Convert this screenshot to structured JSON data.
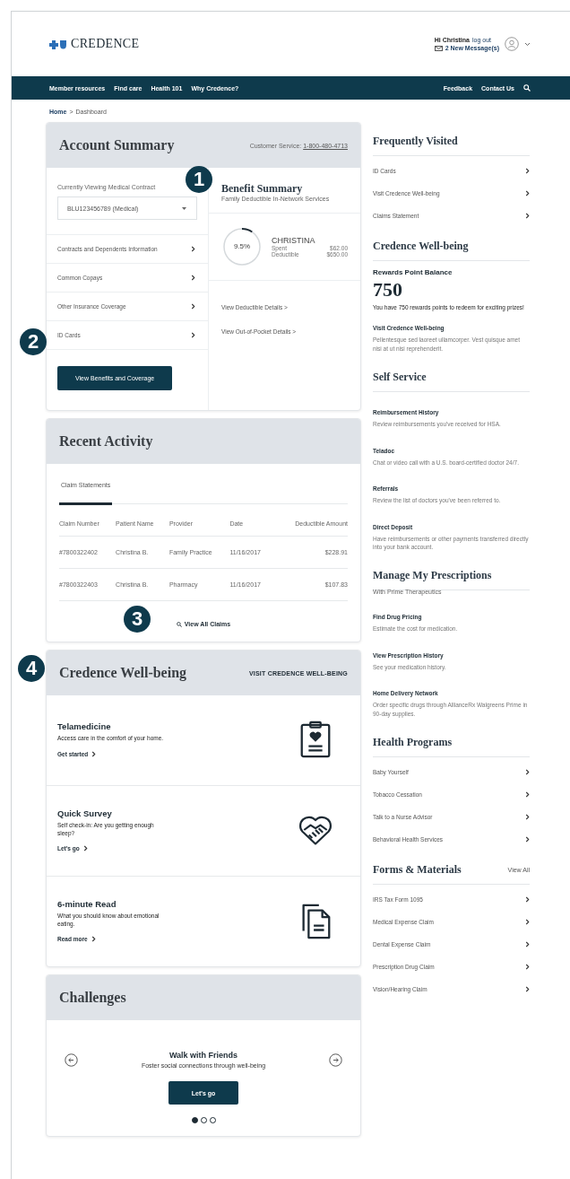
{
  "header": {
    "logo": "CREDENCE",
    "greeting": "Hi Christina",
    "logout": "log out",
    "messages": "2 New Message(s)"
  },
  "nav": {
    "left": [
      "Member resources",
      "Find care",
      "Health 101",
      "Why Credence?"
    ],
    "right": [
      "Feedback",
      "Contact Us"
    ]
  },
  "breadcrumb": {
    "home": "Home",
    "separator": ">",
    "current": "Dashboard"
  },
  "account_summary": {
    "title": "Account Summary",
    "service_label": "Customer Service:",
    "service_phone": "1-800-480-4713",
    "contract_label": "Currently Viewing Medical Contract",
    "contract_value": "BLU123456789 (Medical)",
    "links": [
      "Contracts and Dependents Information",
      "Common Copays",
      "Other Insurance Coverage",
      "ID Cards"
    ],
    "button": "View Benefits and Coverage",
    "benefit_summary": {
      "title": "Benefit Summary",
      "subtitle": "Family Deductible In-Network Services",
      "percent": "9.5%",
      "level": 0.095,
      "member": "CHRISTINA",
      "spent_label": "Spent",
      "spent": "$62.00",
      "deductible_label": "Deductible",
      "deductible": "$650.00",
      "links": [
        "View Deductible Details >",
        "View Out-of-Pocket Details >"
      ]
    }
  },
  "recent_activity": {
    "title": "Recent Activity",
    "tabs": [
      {
        "label": "Claim Statements",
        "selected": true
      }
    ],
    "table": {
      "columns": [
        "Claim Number",
        "Patient Name",
        "Provider",
        "Date",
        "Deductible Amount"
      ],
      "rows": [
        [
          "#7800322402",
          "Christina B.",
          "Family Practice",
          "11/16/2017",
          "$228.91"
        ],
        [
          "#7800322403",
          "Christina B.",
          "Pharmacy",
          "11/16/2017",
          "$107.83"
        ]
      ]
    },
    "view_all": "View All Claims"
  },
  "wellbeing": {
    "title": "Credence Well-being",
    "link": "VISIT CREDENCE WELL-BEING",
    "items": [
      {
        "kind": "clipboard",
        "title": "Telamedicine",
        "text": "Access care in the comfort of your home.",
        "action": "Get started"
      },
      {
        "kind": "handshake",
        "title": "Quick Survey",
        "text": "Self check-in: Are you getting enough sleep?",
        "action": "Let's go"
      },
      {
        "kind": "documents",
        "title": "6-minute Read",
        "text": "What you should know about emotional eating.",
        "action": "Read more"
      }
    ]
  },
  "challenges": {
    "title": "Challenges",
    "card_title": "Walk with Friends",
    "card_text": "Foster social connections through well-being",
    "button": "Let's go",
    "dots": [
      {
        "selected": true
      },
      {
        "selected": false
      },
      {
        "selected": false
      }
    ]
  },
  "sidebar": [
    {
      "kind": "links",
      "title": "Frequently Visited",
      "items": [
        "ID Cards",
        "Visit Credence Well-being",
        "Claims Statement"
      ]
    },
    {
      "kind": "rewards",
      "title": "Credence Well-being",
      "label": "Rewards Point Balance",
      "points": "750",
      "text": "You have 750 rewards points to redeem for exciting prizes!",
      "link": "Visit Credence Well-being",
      "link_text": "Pellentesque sed laoreet ullamcorper. Vest quisque amet nisi at ut nisi reprehenderit."
    },
    {
      "kind": "described",
      "title": "Self Service",
      "items": [
        {
          "title": "Reimbursement History",
          "text": "Review reimbursements you've received for HSA."
        },
        {
          "title": "Teladoc",
          "text": "Chat or video call with a U.S. board-certified doctor 24/7."
        },
        {
          "title": "Referrals",
          "text": "Review the list of doctors you've been referred to."
        },
        {
          "title": "Direct Deposit",
          "text": "Have reimbursements or other payments transferred directly into your bank account."
        }
      ]
    },
    {
      "kind": "described",
      "title": "Manage My Prescriptions",
      "subtitle": "With Prime Therapeutics",
      "items": [
        {
          "title": "Find Drug Pricing",
          "text": "Estimate the cost for medication."
        },
        {
          "title": "View Prescription History",
          "text": "See your medication history."
        },
        {
          "title": "Home Delivery Network",
          "text": "Order specific drugs through AllianceRx Walgreens Prime in 90-day supplies."
        }
      ]
    },
    {
      "kind": "links",
      "title": "Health Programs",
      "items": [
        "Baby Yourself",
        "Tobacco Cessation",
        "Talk to a Nurse Advisor",
        "Behavioral Health Services"
      ]
    },
    {
      "kind": "links",
      "title": "Forms & Materials",
      "action": "View All",
      "items": [
        "IRS Tax Form 1095",
        "Medical Expense Claim",
        "Dental Expense Claim",
        "Prescription Drug Claim",
        "Vision/Hearing Claim"
      ]
    }
  ],
  "callouts": [
    "1",
    "2",
    "3",
    "4"
  ]
}
